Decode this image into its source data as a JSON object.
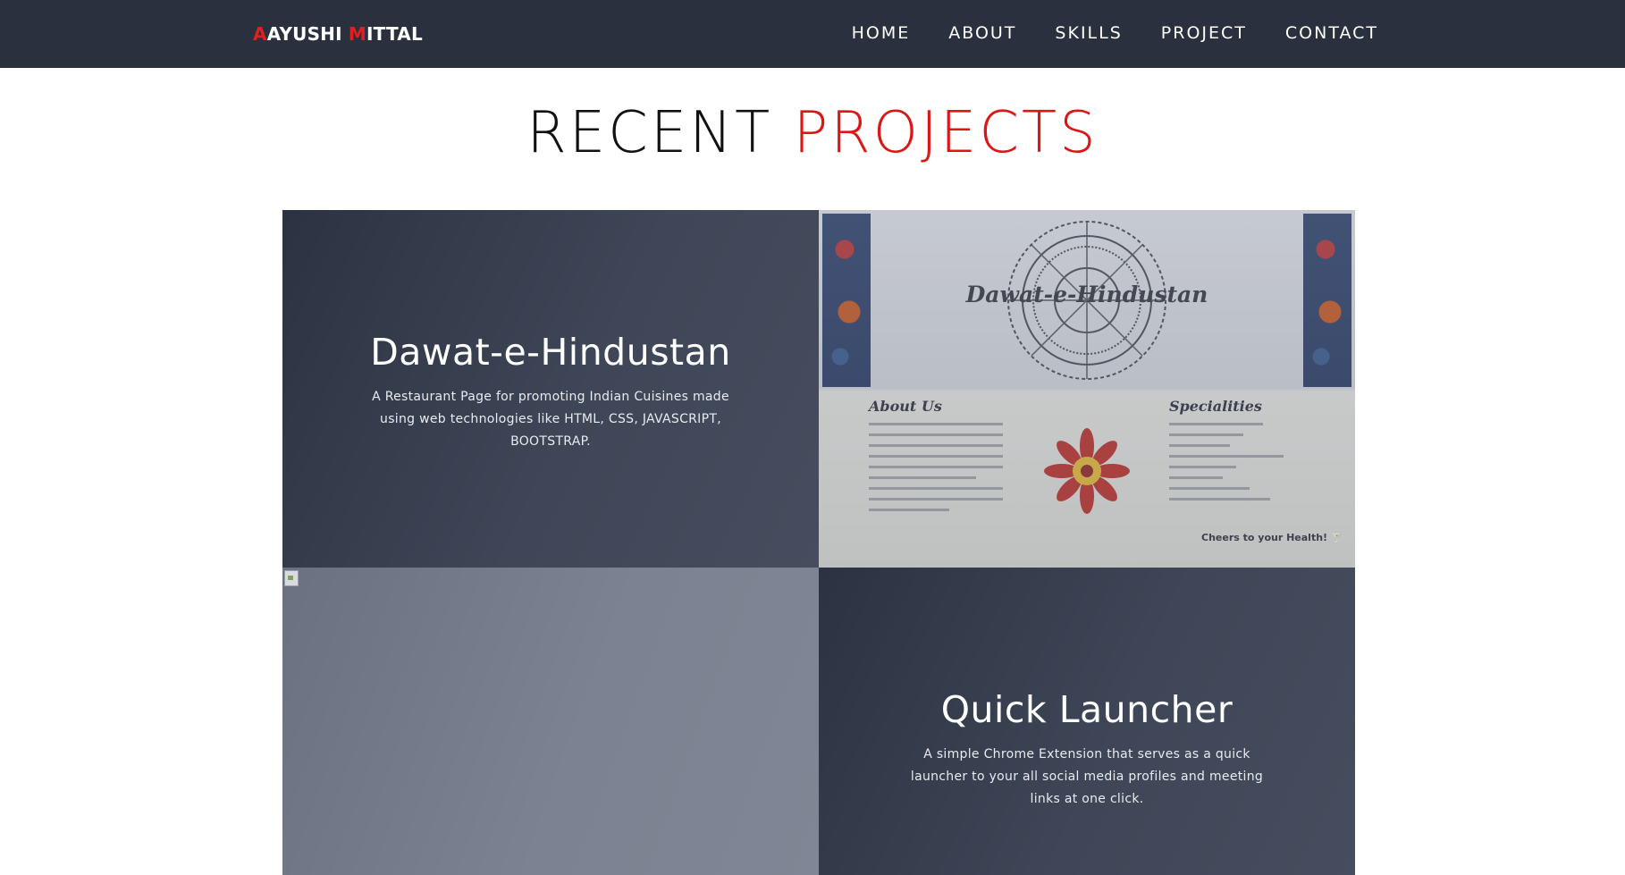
{
  "header": {
    "brand": {
      "first_initial": "A",
      "first_rest": "AYUSHI ",
      "last_initial": "M",
      "last_rest": "ITTAL"
    },
    "nav": [
      "HOME",
      "ABOUT",
      "SKILLS",
      "PROJECT",
      "CONTACT"
    ]
  },
  "section": {
    "title_part1": "RECENT ",
    "title_part2": "PROJECTS"
  },
  "projects": [
    {
      "title": "Dawat-e-Hindustan",
      "description": "A Restaurant Page for promoting Indian Cuisines made using web technologies like HTML, CSS, JAVASCRIPT, BOOTSTRAP.",
      "preview": {
        "name": "Dawat-e-Hindustan",
        "about_heading": "About Us",
        "specialities_heading": "Specialities",
        "cheers": "Cheers to your Health! 🍸"
      }
    },
    {
      "title": "Quick Launcher",
      "description": "A simple Chrome Extension that serves as a quick launcher to your all social media profiles and meeting links at one click."
    }
  ],
  "colors": {
    "navbar": "#2b303e",
    "accent": "#dc1515",
    "card_dark": "#3e4657"
  }
}
